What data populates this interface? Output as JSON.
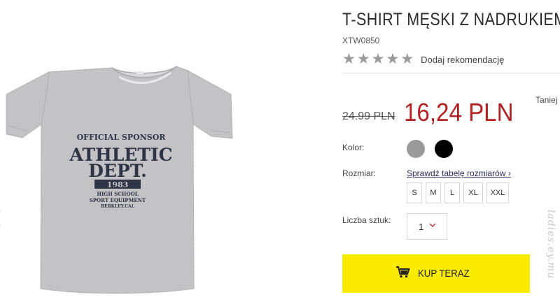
{
  "product": {
    "title": "T-SHIRT MĘSKI Z NADRUKIEM",
    "sku": "XTW0850",
    "rating": {
      "stars": 5,
      "recommend_label": "Dodaj rekomendację"
    },
    "price": {
      "old": "24.99 PLN",
      "new": "16,24 PLN",
      "cheaper_label": "Taniej"
    },
    "print": {
      "line1": "OFFICIAL SPONSOR",
      "line2": "ATHLETIC",
      "line3": "DEPT.",
      "year": "1983",
      "line4": "HIGH SCHOOL",
      "line5": "SPORT EQUIPMENT",
      "line6": "BERKLEY.CAL"
    },
    "watermark": "ladies.ey.mu"
  },
  "options": {
    "color_label": "Kolor:",
    "colors": [
      {
        "name": "gray",
        "hex": "#9a9a9a"
      },
      {
        "name": "black",
        "hex": "#000000"
      }
    ],
    "size_label": "Rozmiar:",
    "size_chart_link": "Sprawdź tabelę rozmiarów ›",
    "sizes": [
      "S",
      "M",
      "L",
      "XL",
      "XXL"
    ],
    "qty_label": "Liczba sztuk:",
    "qty_value": "1"
  },
  "cta": {
    "buy_label": "KUP TERAZ",
    "bg": "#fbeb00"
  },
  "colors": {
    "price_red": "#b22222",
    "star_gray": "#9a9a9a"
  }
}
